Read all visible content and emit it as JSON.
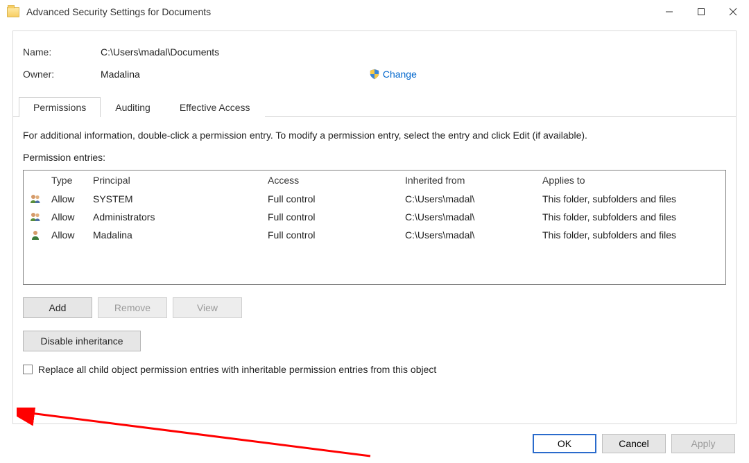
{
  "window": {
    "title": "Advanced Security Settings for Documents"
  },
  "info": {
    "name_label": "Name:",
    "name_value": "C:\\Users\\madal\\Documents",
    "owner_label": "Owner:",
    "owner_value": "Madalina",
    "change_link": "Change"
  },
  "tabs": {
    "permissions": "Permissions",
    "auditing": "Auditing",
    "effective_access": "Effective Access"
  },
  "instructions": "For additional information, double-click a permission entry. To modify a permission entry, select the entry and click Edit (if available).",
  "entries_heading": "Permission entries:",
  "perm_columns": {
    "type": "Type",
    "principal": "Principal",
    "access": "Access",
    "inherited_from": "Inherited from",
    "applies_to": "Applies to"
  },
  "perm_rows": [
    {
      "icon": "group",
      "type": "Allow",
      "principal": "SYSTEM",
      "access": "Full control",
      "inherited": "C:\\Users\\madal\\",
      "applies": "This folder, subfolders and files"
    },
    {
      "icon": "group",
      "type": "Allow",
      "principal": "Administrators",
      "access": "Full control",
      "inherited": "C:\\Users\\madal\\",
      "applies": "This folder, subfolders and files"
    },
    {
      "icon": "user",
      "type": "Allow",
      "principal": "Madalina",
      "access": "Full control",
      "inherited": "C:\\Users\\madal\\",
      "applies": "This folder, subfolders and files"
    }
  ],
  "buttons": {
    "add": "Add",
    "remove": "Remove",
    "view": "View",
    "disable_inheritance": "Disable inheritance"
  },
  "checkbox_label": "Replace all child object permission entries with inheritable permission entries from this object",
  "footer": {
    "ok": "OK",
    "cancel": "Cancel",
    "apply": "Apply"
  }
}
